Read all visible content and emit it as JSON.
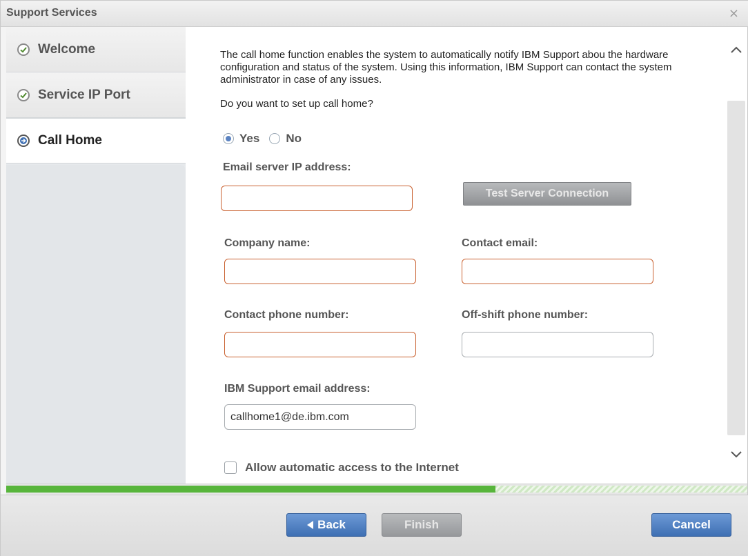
{
  "window": {
    "title": "Support Services",
    "close_icon": "close-icon",
    "close_glyph": "×"
  },
  "sidebar": {
    "items": [
      {
        "label": "Welcome",
        "state": "done",
        "icon": "check-circle-icon"
      },
      {
        "label": "Service IP Port",
        "state": "done",
        "icon": "check-circle-icon"
      },
      {
        "label": "Call Home",
        "state": "active",
        "icon": "arrow-circle-icon"
      }
    ]
  },
  "main": {
    "intro": "The call home function enables the system to automatically notify IBM Support abou the hardware configuration and status of the system. Using this information, IBM Support can contact the system administrator in case of any issues.",
    "question": "Do you want to set up call home?",
    "radios": [
      {
        "label": "Yes",
        "checked": true
      },
      {
        "label": "No",
        "checked": false
      }
    ],
    "email_server": {
      "label": "Email server IP address:",
      "value": ""
    },
    "test_button": "Test Server Connection",
    "company": {
      "label": "Company name:",
      "value": ""
    },
    "contact_email": {
      "label": "Contact email:",
      "value": ""
    },
    "contact_phone": {
      "label": "Contact phone number:",
      "value": ""
    },
    "offshift_phone": {
      "label": "Off-shift phone number:",
      "value": ""
    },
    "ibm_email": {
      "label": "IBM Support email address:",
      "value": "callhome1@de.ibm.com"
    },
    "internet_checkbox": {
      "label": "Allow automatic access to the Internet",
      "checked": false
    }
  },
  "progress": {
    "fraction": 0.66
  },
  "footer": {
    "back": "Back",
    "finish": "Finish",
    "cancel": "Cancel"
  },
  "colors": {
    "accent": "#3e6fb3",
    "invalid_border": "#c9602f",
    "progress": "#57b53b"
  }
}
